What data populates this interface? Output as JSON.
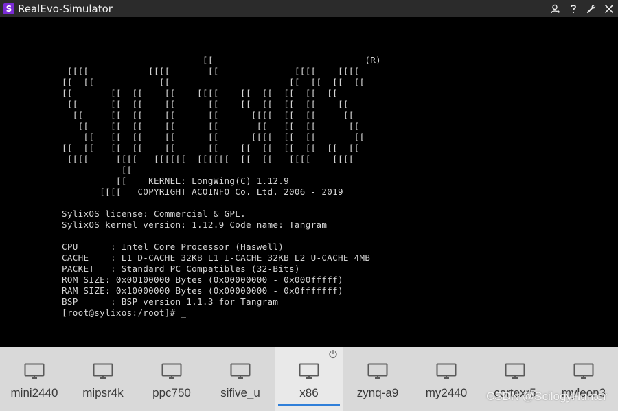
{
  "window": {
    "title": "RealEvo-Simulator",
    "icon_letter": "S"
  },
  "title_buttons": [
    "user-icon",
    "help-icon",
    "wrench-icon",
    "close-icon"
  ],
  "terminal": {
    "lines": [
      "                          [[                            (R)",
      " [[[[           [[[[       [[              [[[[    [[[[",
      "[[  [[            [[                      [[  [[  [[  [[",
      "[[       [[  [[    [[    [[[[    [[  [[  [[  [[  [[",
      " [[      [[  [[    [[      [[    [[  [[  [[  [[    [[",
      "  [[     [[  [[    [[      [[      [[[[  [[  [[     [[",
      "   [[    [[  [[    [[      [[       [[   [[  [[      [[",
      "    [[   [[  [[    [[      [[      [[[[  [[  [[       [[",
      "[[  [[   [[  [[    [[      [[    [[  [[  [[  [[  [[  [[",
      " [[[[     [[[[   [[[[[[  [[[[[[  [[  [[   [[[[    [[[[",
      "           [[",
      "          [[    KERNEL: LongWing(C) 1.12.9",
      "       [[[[   COPYRIGHT ACOINFO Co. Ltd. 2006 - 2019",
      "",
      "SylixOS license: Commercial & GPL.",
      "SylixOS kernel version: 1.12.9 Code name: Tangram",
      "",
      "CPU      : Intel Core Processor (Haswell)",
      "CACHE    : L1 D-CACHE 32KB L1 I-CACHE 32KB L2 U-CACHE 4MB",
      "PACKET   : Standard PC Compatibles (32-Bits)",
      "ROM SIZE: 0x00100000 Bytes (0x00000000 - 0x000fffff)",
      "RAM SIZE: 0x10000000 Bytes (0x00000000 - 0x0fffffff)",
      "BSP      : BSP version 1.1.3 for Tangram",
      "[root@sylixos:/root]# _"
    ]
  },
  "targets": [
    {
      "label": "mini2440",
      "active": false
    },
    {
      "label": "mipsr4k",
      "active": false
    },
    {
      "label": "ppc750",
      "active": false
    },
    {
      "label": "sifive_u",
      "active": false
    },
    {
      "label": "x86",
      "active": true
    },
    {
      "label": "zynq-a9",
      "active": false
    },
    {
      "label": "my2440",
      "active": false
    },
    {
      "label": "cortexr5",
      "active": false
    },
    {
      "label": "myleon3",
      "active": false
    }
  ],
  "watermark": "CSDN @ScilogyHunter",
  "colors": {
    "titlebar": "#2b2b2b",
    "terminal_bg": "#000000",
    "terminal_fg": "#d4d4d4",
    "tabbar_bg": "#d9d9d9",
    "active_tab_bg": "#e9e9e9",
    "active_underline": "#2f7fd9",
    "app_icon": "#7a2bd6"
  }
}
